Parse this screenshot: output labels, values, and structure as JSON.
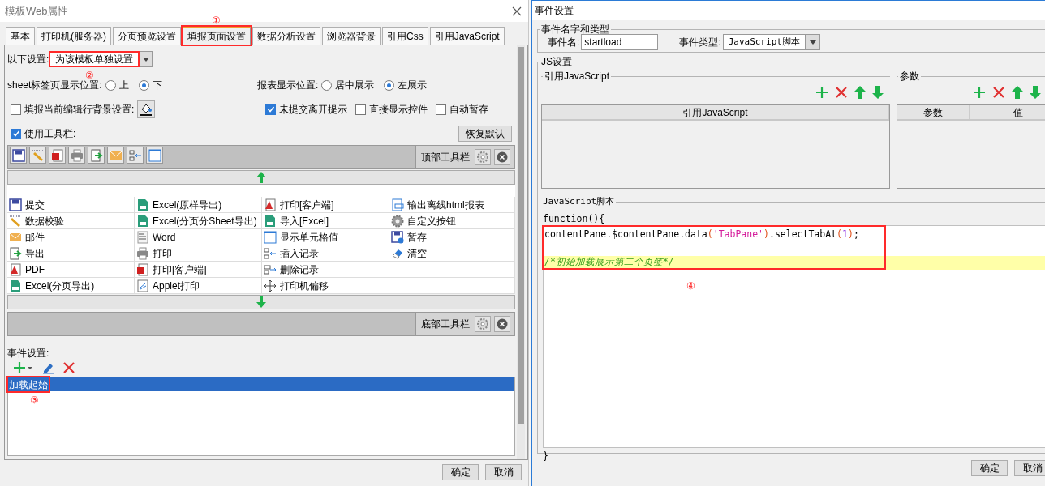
{
  "left_dialog": {
    "title": "模板Web属性",
    "tabs": [
      {
        "label": "基本",
        "selected": false,
        "highlighted": false
      },
      {
        "label": "打印机(服务器)",
        "selected": false,
        "highlighted": false
      },
      {
        "label": "分页预览设置",
        "selected": false,
        "highlighted": false
      },
      {
        "label": "填报页面设置",
        "selected": true,
        "highlighted": true,
        "callout": "①"
      },
      {
        "label": "数据分析设置",
        "selected": false,
        "highlighted": false
      },
      {
        "label": "浏览器背景",
        "selected": false,
        "highlighted": false
      },
      {
        "label": "引用Css",
        "selected": false,
        "highlighted": false
      },
      {
        "label": "引用JavaScript",
        "selected": false,
        "highlighted": false
      }
    ],
    "scope": {
      "label": "以下设置:",
      "value": "为该模板单独设置",
      "highlighted": true,
      "callout": "②"
    },
    "radio_groups": [
      {
        "label": "sheet标签页显示位置:",
        "options": [
          {
            "label": "上",
            "selected": false
          },
          {
            "label": "下",
            "selected": true
          }
        ]
      },
      {
        "label": "报表显示位置:",
        "options": [
          {
            "label": "居中展示",
            "selected": false
          },
          {
            "label": "左展示",
            "selected": true
          }
        ]
      }
    ],
    "checkboxes": [
      {
        "label": "填报当前编辑行背景设置:",
        "checked": false,
        "kind": "color"
      },
      {
        "label": "未提交离开提示",
        "checked": true,
        "kind": "plain"
      },
      {
        "label": "直接显示控件",
        "checked": false,
        "kind": "plain"
      },
      {
        "label": "自动暂存",
        "checked": false,
        "kind": "plain"
      }
    ],
    "use_toolbar": {
      "label": "使用工具栏:",
      "checked": true
    },
    "restore_button": "恢复默认",
    "top_toolbar": {
      "label": "顶部工具栏",
      "buttons": [
        {
          "kind": "save"
        },
        {
          "kind": "pencil"
        },
        {
          "kind": "flash"
        },
        {
          "kind": "print"
        },
        {
          "kind": "export"
        },
        {
          "kind": "mail"
        },
        {
          "kind": "insert"
        },
        {
          "kind": "cell"
        }
      ]
    },
    "button_grid": [
      [
        {
          "label": "提交",
          "kind": "save"
        },
        {
          "label": "Excel(原样导出)",
          "kind": "excel"
        },
        {
          "label": "打印[客户端]",
          "kind": "pdf"
        },
        {
          "label": "输出离线html报表",
          "kind": "html"
        }
      ],
      [
        {
          "label": "数据校验",
          "kind": "pencil"
        },
        {
          "label": "Excel(分页分Sheet导出)",
          "kind": "excel"
        },
        {
          "label": "导入[Excel]",
          "kind": "excel"
        },
        {
          "label": "自定义按钮",
          "kind": "gear"
        }
      ],
      [
        {
          "label": "邮件",
          "kind": "mail"
        },
        {
          "label": "Word",
          "kind": "word"
        },
        {
          "label": "显示单元格值",
          "kind": "cell"
        },
        {
          "label": "暂存",
          "kind": "tempsave"
        }
      ],
      [
        {
          "label": "导出",
          "kind": "export"
        },
        {
          "label": "打印",
          "kind": "print"
        },
        {
          "label": "插入记录",
          "kind": "insert"
        },
        {
          "label": "清空",
          "kind": "eraser"
        }
      ],
      [
        {
          "label": "PDF",
          "kind": "pdf"
        },
        {
          "label": "打印[客户端]",
          "kind": "flash"
        },
        {
          "label": "删除记录",
          "kind": "delete"
        }
      ],
      [
        {
          "label": "Excel(分页导出)",
          "kind": "excel"
        },
        {
          "label": "Applet打印",
          "kind": "applet"
        },
        {
          "label": "打印机偏移",
          "kind": "move"
        }
      ]
    ],
    "bottom_toolbar": {
      "label": "底部工具栏"
    },
    "events": {
      "label": "事件设置:",
      "items": [
        {
          "label": "加载起始",
          "selected": true,
          "highlighted": true,
          "callout": "③"
        }
      ]
    },
    "buttons": [
      "确定",
      "取消"
    ]
  },
  "right_dialog": {
    "title": "事件设置",
    "name_type": {
      "legend": "事件名字和类型",
      "name_label": "事件名:",
      "name_value": "startload",
      "type_label": "事件类型:",
      "type_value": "JavaScript脚本"
    },
    "js_settings": {
      "legend": "JS设置",
      "references": {
        "legend": "引用JavaScript",
        "columns": [
          "引用JavaScript"
        ]
      },
      "parameters": {
        "legend": "参数",
        "columns": [
          "参数",
          "值"
        ]
      },
      "script_label": "JavaScript脚本",
      "header": "function(){",
      "lines": [
        {
          "highlighted": false,
          "tokens": [
            {
              "text": "contentPane.$contentPane.data",
              "kind": "plain"
            },
            {
              "text": "(",
              "kind": "paren"
            },
            {
              "text": "'TabPane'",
              "kind": "string"
            },
            {
              "text": ")",
              "kind": "paren"
            },
            {
              "text": ".selectTabAt",
              "kind": "plain"
            },
            {
              "text": "(",
              "kind": "paren"
            },
            {
              "text": "1",
              "kind": "number"
            },
            {
              "text": ")",
              "kind": "paren"
            },
            {
              "text": ";",
              "kind": "plain"
            }
          ]
        },
        {
          "highlighted": false
        },
        {
          "highlighted": true,
          "tokens": [
            {
              "text": "/*初始加载展示第二个页签*/",
              "kind": "comment"
            }
          ]
        }
      ],
      "code_highlighted": true,
      "code_callout": "④",
      "footer": "}"
    },
    "buttons": [
      "确定",
      "取消"
    ]
  }
}
